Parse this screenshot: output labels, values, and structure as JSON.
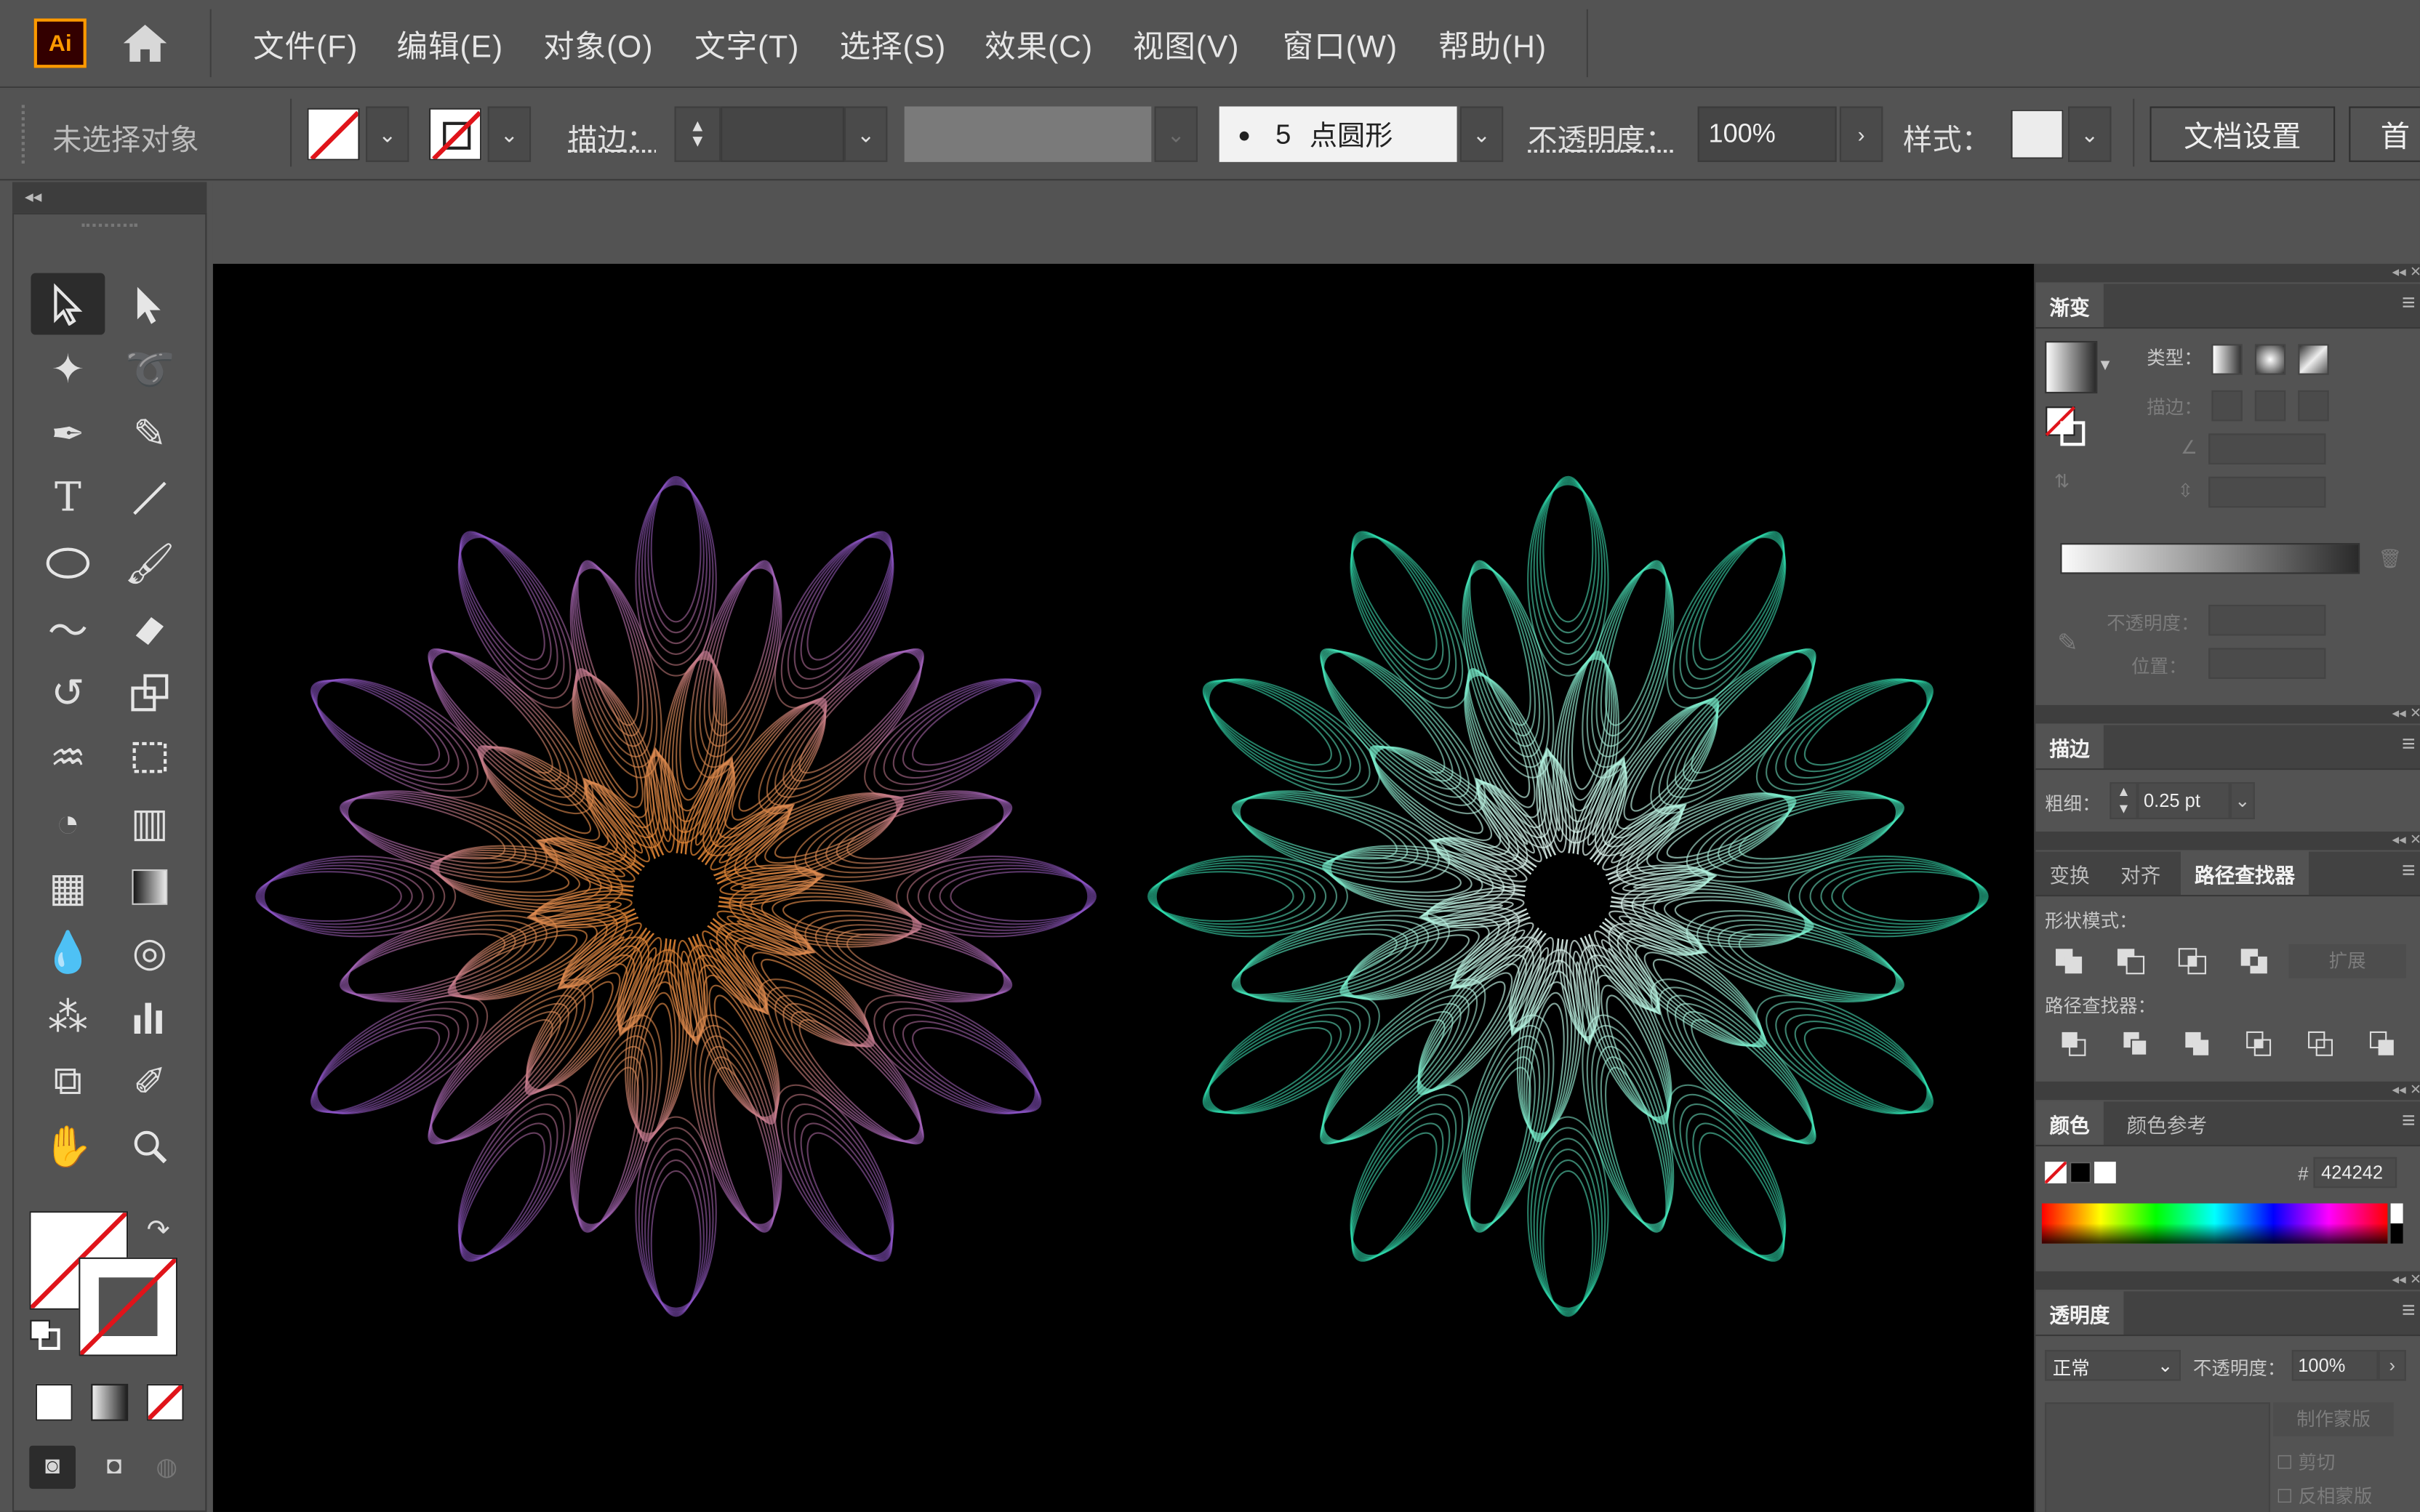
{
  "app": {
    "logo": "Ai"
  },
  "menu": [
    "文件(F)",
    "编辑(E)",
    "对象(O)",
    "文字(T)",
    "选择(S)",
    "效果(C)",
    "视图(V)",
    "窗口(W)",
    "帮助(H)"
  ],
  "control_bar": {
    "selection_status": "未选择对象",
    "stroke_label": "描边：",
    "brush_size": "5",
    "brush_name": "点圆形",
    "opacity_label": "不透明度：",
    "opacity_value": "100%",
    "style_label": "样式：",
    "doc_settings": "文档设置",
    "prefs_partial": "首"
  },
  "panels": {
    "gradient": {
      "tab": "渐变",
      "type_label": "类型：",
      "stroke_label": "描边：",
      "opacity_label": "不透明度：",
      "location_label": "位置："
    },
    "stroke": {
      "tab": "描边",
      "weight_label": "粗细：",
      "weight_value": "0.25 pt"
    },
    "pathfinder": {
      "tabs": [
        "变换",
        "对齐",
        "路径查找器"
      ],
      "shape_modes": "形状模式：",
      "pathfinders": "路径查找器：",
      "expand": "扩展"
    },
    "color": {
      "tabs": [
        "颜色",
        "颜色参考"
      ],
      "hex_symbol": "#",
      "hex_value": "424242"
    },
    "transparency": {
      "tab": "透明度",
      "blend_mode": "正常",
      "opacity_label": "不透明度：",
      "opacity_value": "100%",
      "make_mask": "制作蒙版",
      "clip": "剪切",
      "invert_mask": "反相蒙版"
    }
  },
  "artwork": {
    "flower_left": {
      "center_color": "#f08a2a",
      "outer_color": "#8e55c9"
    },
    "flower_right": {
      "center_color": "#ffffff",
      "outer_color": "#2ee0b0"
    }
  },
  "colors": {
    "ui_bg": "#535353",
    "canvas": "#000000",
    "accent_logo": "#ff9a00"
  }
}
